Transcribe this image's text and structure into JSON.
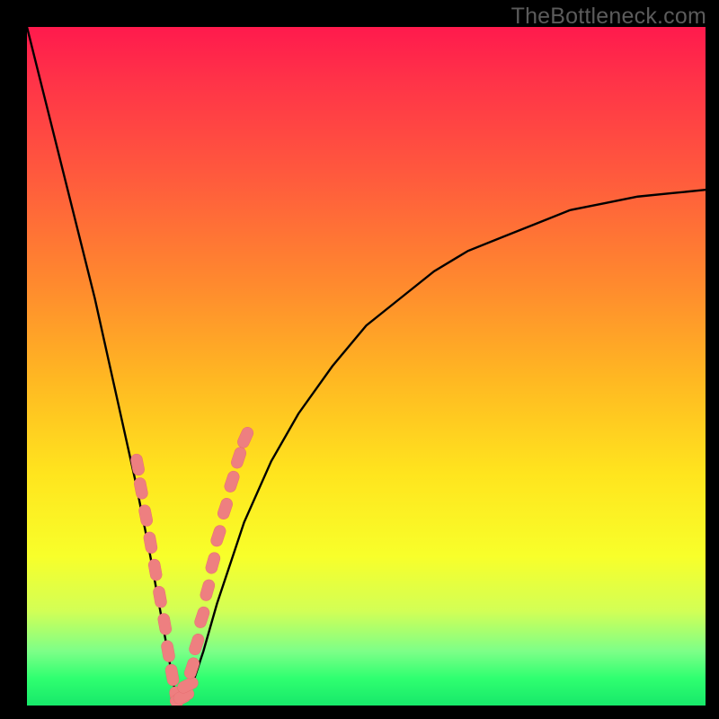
{
  "watermark": "TheBottleneck.com",
  "colors": {
    "frame": "#000000",
    "curve": "#000000",
    "marker_fill": "#ee7f80",
    "marker_stroke": "#e76f70"
  },
  "chart_data": {
    "type": "line",
    "title": "",
    "xlabel": "",
    "ylabel": "",
    "xlim": [
      0,
      100
    ],
    "ylim": [
      0,
      100
    ],
    "note": "Axes are unlabeled; x and y are normalized 0–100 percentages of the plot area. The curve appears to be a bottleneck/absolute-deviation style plot dipping to ~0 near x≈22 then rising toward ~76 at x=100.",
    "series": [
      {
        "name": "curve",
        "x": [
          0,
          2,
          4,
          6,
          8,
          10,
          12,
          14,
          16,
          18,
          20,
          22,
          24,
          26,
          28,
          30,
          32,
          36,
          40,
          45,
          50,
          55,
          60,
          65,
          70,
          75,
          80,
          85,
          90,
          95,
          100
        ],
        "y": [
          100,
          92,
          84,
          76,
          68,
          60,
          51,
          42,
          33,
          23,
          12,
          1,
          2,
          8,
          15,
          21,
          27,
          36,
          43,
          50,
          56,
          60,
          64,
          67,
          69,
          71,
          73,
          74,
          75,
          75.5,
          76
        ]
      }
    ],
    "markers": {
      "name": "highlighted-points",
      "note": "Pink lozenge markers clustered along both flanks near the valley and along the floor.",
      "x": [
        16.3,
        16.8,
        17.5,
        18.2,
        18.9,
        19.6,
        20.3,
        20.8,
        21.4,
        22.0,
        22.6,
        23.1,
        23.7,
        24.3,
        25.0,
        25.8,
        26.6,
        27.4,
        28.2,
        29.2,
        30.2,
        31.2,
        32.2
      ],
      "y": [
        35.5,
        32.0,
        28.0,
        24.0,
        20.0,
        16.0,
        12.0,
        8.0,
        4.5,
        1.2,
        1.0,
        1.4,
        3.0,
        5.5,
        9.0,
        13.0,
        17.0,
        21.0,
        25.0,
        29.0,
        33.0,
        36.5,
        39.5
      ]
    }
  }
}
